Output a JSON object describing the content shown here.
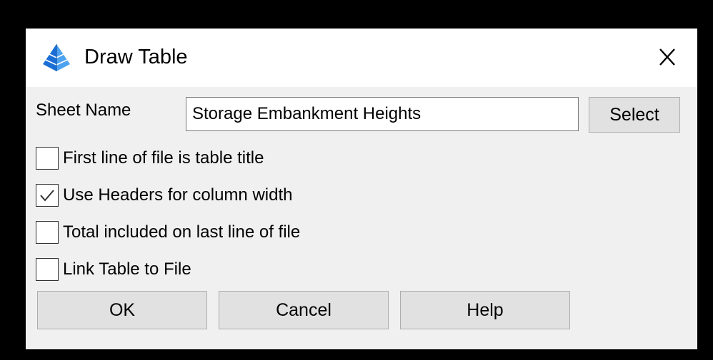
{
  "dialog": {
    "title": "Draw Table",
    "title_icon": "blue-pyramid-icon",
    "close_icon": "close-icon",
    "colors": {
      "icon_blue": "#1a6fd6",
      "icon_blue_light": "#4ea3f0",
      "title_bar": "#ffffff",
      "body": "#f0f0f0"
    }
  },
  "sheet": {
    "label": "Sheet Name",
    "value": "Storage Embankment Heights",
    "select_label": "Select"
  },
  "options": [
    {
      "label": "First line of file is table title",
      "checked": false
    },
    {
      "label": "Use Headers for column width",
      "checked": true
    },
    {
      "label": "Total included on last line of file",
      "checked": false
    },
    {
      "label": "Link Table to File",
      "checked": false
    }
  ],
  "buttons": {
    "ok": "OK",
    "cancel": "Cancel",
    "help": "Help"
  }
}
